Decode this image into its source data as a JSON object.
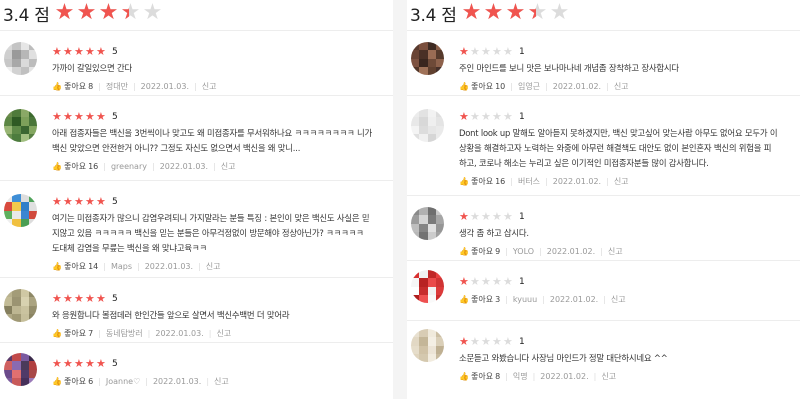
{
  "left": {
    "score": "3.4 점",
    "score_fill_fraction": 0.68,
    "reviews": [
      {
        "rating": 5,
        "text": [
          "가까이 갈일있으면 간다"
        ],
        "like_label": "좋아요",
        "likes": "8",
        "author": "정대만",
        "date": "2022.01.03.",
        "report": "신고",
        "avatar": [
          "#d9d9d9",
          "#c4c4c4",
          "#e6e6e6",
          "#bdbdbd",
          "#cfcfcf",
          "#9a9a9a",
          "#b7b7b7",
          "#e0e0e0",
          "#c7c7c7",
          "#a8a8a8",
          "#dadada",
          "#bcbcbc",
          "#eeeeee",
          "#d2d2d2",
          "#c0c0c0",
          "#e4e4e4"
        ]
      },
      {
        "rating": 5,
        "text": [
          "아래 접종자들은 백신을 3번씩이나 맞고도 왜 미접종자를 무서워하나요 ㅋㅋㅋㅋㅋㅋㅋㅋ 니가",
          "백신 맞았으면 안전한거 아니?? 그정도 자신도 없으면서 백신을 왜 맞니..."
        ],
        "like_label": "좋아요",
        "likes": "16",
        "author": "greenary",
        "date": "2022.01.03.",
        "report": "신고",
        "avatar": [
          "#6c8c4c",
          "#4f7a3a",
          "#8aa866",
          "#3d6a2e",
          "#5c8644",
          "#2f5a24",
          "#7da05a",
          "#4a763a",
          "#98b574",
          "#5f8a48",
          "#3a6630",
          "#83a660",
          "#6a9250",
          "#4d7c3e",
          "#a2bf80",
          "#577f42"
        ]
      },
      {
        "rating": 5,
        "text": [
          "여기는 미접종자가 많으니 감염우려되니 가지말라는 분들 특징 : 본인이 맞은 백신도 사실은 믿",
          "지않고 있음 ㅋㅋㅋㅋㅋ 백신을 믿는 분들은 아무걱정없이 방문해야 정상아닌가? ㅋㅋㅋㅋㅋ",
          "도대체 감염을 무릎는 백신을 왜 맞냐고육ㅋㅋ"
        ],
        "like_label": "좋아요",
        "likes": "14",
        "author": "Maps",
        "date": "2022.01.03.",
        "report": "신고",
        "avatar": [
          "#e8e8e8",
          "#3e8ed6",
          "#dddddd",
          "#4fa35a",
          "#d84a3e",
          "#f2c94c",
          "#2f7fc9",
          "#e0e0e0",
          "#5fb05e",
          "#e9e9e9",
          "#3b86d2",
          "#d14a3d",
          "#eeeeee",
          "#f0c040",
          "#4a9e54",
          "#dcdcdc"
        ]
      },
      {
        "rating": 5,
        "text": [
          "와 응원합니다 볼점데러 한인간들 앞으로 살면서 백신수백번 더 맞어라"
        ],
        "like_label": "좋아요",
        "likes": "7",
        "author": "동네탐방러",
        "date": "2022.01.03.",
        "report": "신고",
        "avatar": [
          "#b9b28e",
          "#a39c78",
          "#cfc8a4",
          "#8e8866",
          "#c2bb96",
          "#9b9472",
          "#d8d2b0",
          "#aaa380",
          "#857f5e",
          "#bdb692",
          "#cac39f",
          "#948d6b",
          "#b0a985",
          "#a09975",
          "#c6bf9b",
          "#8a8462"
        ]
      },
      {
        "rating": 5,
        "text": [],
        "like_label": "좋아요",
        "likes": "6",
        "author": "Joanne♡",
        "date": "2022.01.03.",
        "report": "신고",
        "avatar": [
          "#5a3a6a",
          "#c14a4a",
          "#7a5aa0",
          "#3a2a4a",
          "#d06060",
          "#8a6ab0",
          "#4a3a5a",
          "#b04040",
          "#6a4a8a",
          "#e07070",
          "#503a68",
          "#a84848",
          "#7c5c9c",
          "#c85a5a",
          "#46305a",
          "#9a7ab8"
        ]
      }
    ]
  },
  "right": {
    "score": "3.4 점",
    "score_fill_fraction": 0.68,
    "reviews": [
      {
        "rating": 1,
        "text": [
          "주인 마인드를 보니 맛은 보나마나네 개념좀 장착하고 장사합시다"
        ],
        "like_label": "좋아요",
        "likes": "10",
        "author": "임영근",
        "date": "2022.01.02.",
        "report": "신고",
        "avatar": [
          "#5a3a2e",
          "#7a4e3c",
          "#3e2a22",
          "#8a5e48",
          "#6a4434",
          "#4a3026",
          "#9a6c54",
          "#563a2c",
          "#7e5240",
          "#3a261e",
          "#6e4a38",
          "#8e624c",
          "#523628",
          "#a07258",
          "#60402f",
          "#46302a"
        ]
      },
      {
        "rating": 1,
        "text": [
          "Dont look up 말해도 알아듣지 못하겠지만, 백신 맞고싶어 맞는사람 아무도 없어요 모두가 이",
          "상황을 해결하고자 노력하는 와중에 아무런 해결책도 대안도 없이 본인혼자 백신의 위험을 피",
          "하고, 코로나 해소는 누리고 싶은 이기적인 미접종자분들 많이 감사합니다."
        ],
        "like_label": "좋아요",
        "likes": "16",
        "author": "버터스",
        "date": "2022.01.02.",
        "report": "신고",
        "avatar": [
          "#ececec",
          "#e2e2e2",
          "#f2f2f2",
          "#dedede",
          "#e8e8e8",
          "#d8d8d8",
          "#efefef",
          "#e4e4e4",
          "#f4f4f4",
          "#dcdcdc",
          "#e6e6e6",
          "#eaeaea",
          "#e0e0e0",
          "#f0f0f0",
          "#d6d6d6",
          "#ebebeb"
        ]
      },
      {
        "rating": 1,
        "text": [
          "생각 좀 하고 삽시다."
        ],
        "like_label": "좋아요",
        "likes": "9",
        "author": "YOLO",
        "date": "2022.01.02.",
        "report": "신고",
        "avatar": [
          "#8a8a8a",
          "#b0b0b0",
          "#6e6e6e",
          "#c8c8c8",
          "#9c9c9c",
          "#d4d4d4",
          "#7a7a7a",
          "#a6a6a6",
          "#bebebe",
          "#848484",
          "#e0e0e0",
          "#969696",
          "#b8b8b8",
          "#727272",
          "#cccccc",
          "#a0a0a0"
        ]
      },
      {
        "rating": 1,
        "text": [],
        "like_label": "좋아요",
        "likes": "3",
        "author": "kyuuu",
        "date": "2022.01.02.",
        "report": "신고",
        "avatar": [
          "#d83030",
          "#f0f0f0",
          "#c02828",
          "#e84040",
          "#f6f6f6",
          "#b82222",
          "#ea4a4a",
          "#d03434",
          "#ffffff",
          "#c62c2c",
          "#f2f2f2",
          "#dc3a3a",
          "#b01e1e",
          "#ee5050",
          "#fafafa",
          "#cc2e2e"
        ]
      },
      {
        "rating": 1,
        "text": [
          "소문듣고 와봤습니다 사장님 마인드가 정말 대단하시네요 ^^"
        ],
        "like_label": "좋아요",
        "likes": "8",
        "author": "익명",
        "date": "2022.01.02.",
        "report": "신고",
        "avatar": [
          "#e8e0d0",
          "#d8ccb4",
          "#f0eadc",
          "#ccbfa4",
          "#e2d8c4",
          "#c4b698",
          "#f4efe4",
          "#dacfb8",
          "#e6ddca",
          "#d0c2a6",
          "#ece4d6",
          "#bfb092",
          "#e0d5bf",
          "#d4c8ae",
          "#f2ecdf",
          "#c8ba9e"
        ]
      }
    ]
  }
}
